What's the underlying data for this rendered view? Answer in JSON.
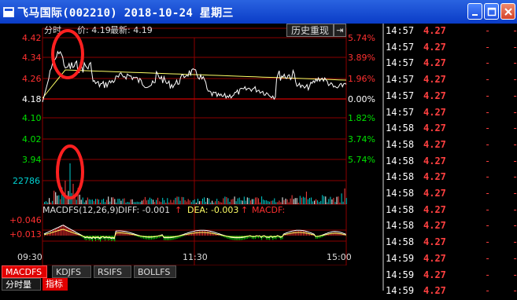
{
  "window": {
    "title": "飞马国际(002210) 2018-10-24 星期三",
    "buttons": [
      "minimize",
      "maximize",
      "close"
    ]
  },
  "chart": {
    "header_label": "分时",
    "header_price_label": "价: 4.19",
    "header_latest": "最新: 4.19",
    "history_button": "历史重现",
    "history_arrow": "⇥",
    "price_axis_left": [
      "4.42",
      "4.34",
      "4.26",
      "4.18",
      "4.10",
      "4.02",
      "3.94"
    ],
    "price_axis_right": [
      "5.74%",
      "3.89%",
      "1.96%",
      "0.00%",
      "1.82%",
      "3.74%",
      "5.74%"
    ],
    "volume_max": "22786",
    "macd_label": "MACDFS(12,26,9)",
    "diff_label": "DIFF: -0.001",
    "dea_label": "DEA: -0.003",
    "macdf_label": "MACDF:",
    "macd_axis": [
      "+0.046",
      "+0.013"
    ],
    "time_axis": [
      "09:30",
      "11:30",
      "15:00"
    ],
    "colors": {
      "up": "#ff3030",
      "down": "#00e000",
      "price_line": "#ffffff",
      "avg_line": "#ffff66",
      "grid": "#8b0000",
      "volume": "#00d0d0",
      "annotation": "#ff2020"
    }
  },
  "tabs": {
    "indicator_tabs": [
      "MACDFS",
      "KDJFS",
      "RSIFS",
      "BOLLFS"
    ],
    "active_tab": "MACDFS",
    "bottom_tabs": [
      "分时量",
      "指标"
    ]
  },
  "ticks": [
    {
      "time": "14:57",
      "price": "4.27"
    },
    {
      "time": "14:57",
      "price": "4.27"
    },
    {
      "time": "14:57",
      "price": "4.27"
    },
    {
      "time": "14:57",
      "price": "4.27"
    },
    {
      "time": "14:57",
      "price": "4.27"
    },
    {
      "time": "14:57",
      "price": "4.27"
    },
    {
      "time": "14:58",
      "price": "4.27"
    },
    {
      "time": "14:58",
      "price": "4.27"
    },
    {
      "time": "14:58",
      "price": "4.27"
    },
    {
      "time": "14:58",
      "price": "4.27"
    },
    {
      "time": "14:58",
      "price": "4.27"
    },
    {
      "time": "14:58",
      "price": "4.27"
    },
    {
      "time": "14:58",
      "price": "4.27"
    },
    {
      "time": "14:58",
      "price": "4.27"
    },
    {
      "time": "14:59",
      "price": "4.27"
    },
    {
      "time": "14:59",
      "price": "4.27"
    },
    {
      "time": "14:59",
      "price": "4.27"
    }
  ],
  "tick_dash": "-"
}
